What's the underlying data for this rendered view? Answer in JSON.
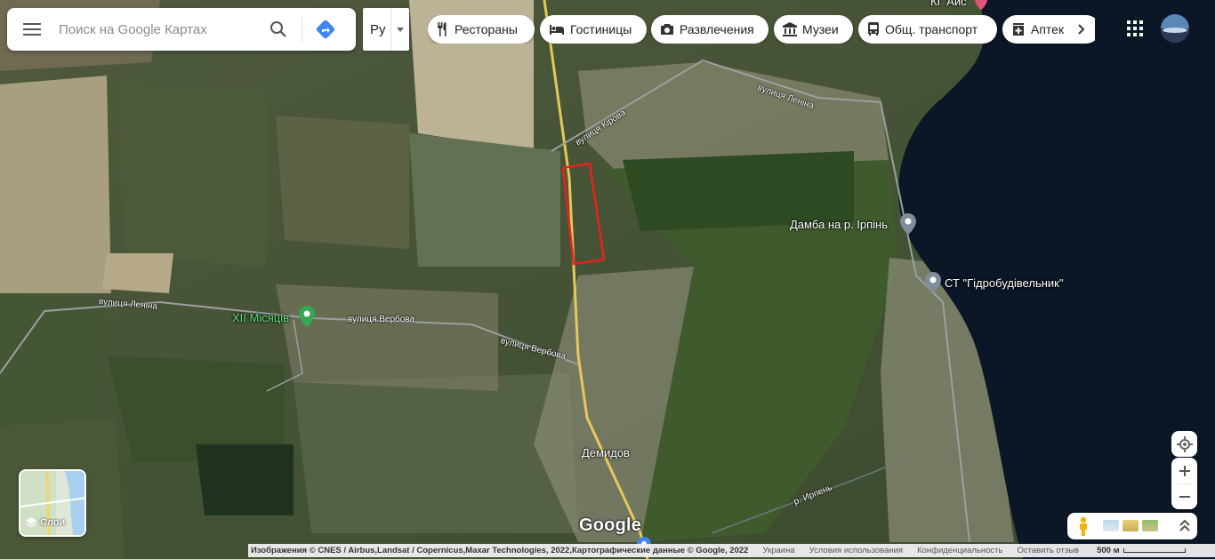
{
  "search": {
    "placeholder": "Поиск на Google Картах"
  },
  "language": {
    "selected": "Ру"
  },
  "chips": [
    {
      "label": "Рестораны",
      "icon": "fork-knife-icon"
    },
    {
      "label": "Гостиницы",
      "icon": "bed-icon"
    },
    {
      "label": "Развлечения",
      "icon": "camera-icon"
    },
    {
      "label": "Музеи",
      "icon": "museum-icon"
    },
    {
      "label": "Общ. транспорт",
      "icon": "bus-icon"
    },
    {
      "label": "Аптек",
      "icon": "pharmacy-icon"
    }
  ],
  "map": {
    "roads": {
      "kirova": "вулиця Кірова",
      "lenina_east": "вулиця Леніна",
      "lenina_west": "вулиця Леніна",
      "verbova_1": "вулиця Вербова",
      "verbova_2": "вулиця Вербова",
      "river": "р. Ирпень"
    },
    "places": {
      "xii_misyatsiv": "XII Місяців",
      "damba": "Дамба на р. Ірпінь",
      "st_gidro": "СТ \"Гідробудівельник\"",
      "demidov": "Демидов",
      "top_partial": "КГ Аис"
    }
  },
  "layers": {
    "label": "Слои"
  },
  "google_logo": "Google",
  "attribution": {
    "imagery": "Изображения © CNES / Airbus,Landsat / Copernicus,Maxar Technologies, 2022,Картографические данные © Google, 2022",
    "country": "Украина",
    "terms": "Условия использования",
    "privacy": "Конфиденциальность",
    "feedback": "Оставить отзыв",
    "scale": "500 м"
  },
  "colors": {
    "pin_gray": "#7f8c9a",
    "pin_green": "#34a853",
    "highlight_rect": "#e8211d",
    "water": "#0b1626",
    "directions_blue": "#4285f4"
  }
}
